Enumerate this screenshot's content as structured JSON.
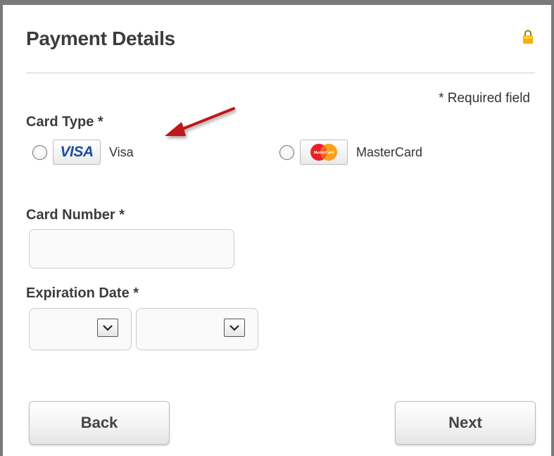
{
  "header": {
    "title": "Payment Details",
    "lock_icon": "lock-icon"
  },
  "required_note": "* Required field",
  "card_type": {
    "label": "Card Type *",
    "options": [
      {
        "label": "Visa",
        "logo_text": "VISA",
        "selected": false
      },
      {
        "label": "MasterCard",
        "logo_text": "MasterCard",
        "selected": false
      }
    ]
  },
  "card_number": {
    "label": "Card Number *",
    "value": "",
    "placeholder": ""
  },
  "expiration": {
    "label": "Expiration Date *",
    "month_value": "",
    "year_value": ""
  },
  "buttons": {
    "back": "Back",
    "next": "Next"
  },
  "colors": {
    "panel_border": "#7a7a7a",
    "lock": "#f0b400",
    "visa_blue": "#1a4fa0",
    "mastercard_red": "#e8202a",
    "mastercard_orange": "#f9a11b",
    "annotation_red": "#c0151a"
  }
}
